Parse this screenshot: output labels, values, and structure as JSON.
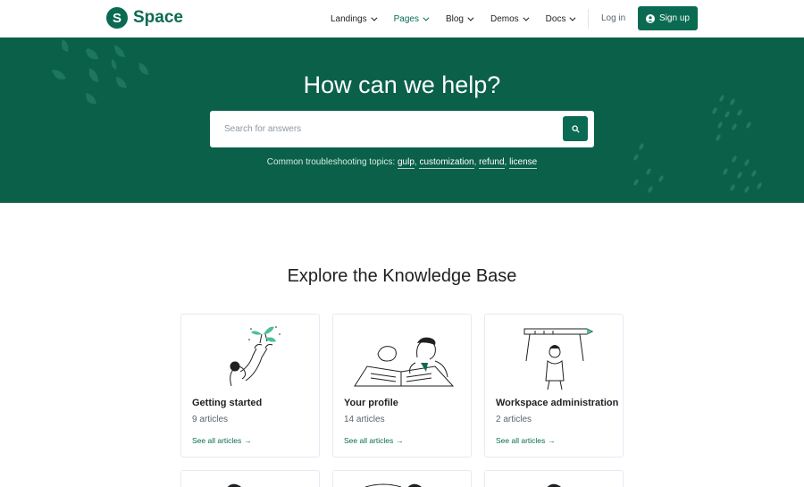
{
  "header": {
    "logo_letter": "S",
    "logo_text": "Space",
    "nav": [
      {
        "label": "Landings"
      },
      {
        "label": "Pages"
      },
      {
        "label": "Blog"
      },
      {
        "label": "Demos"
      },
      {
        "label": "Docs"
      }
    ],
    "login_label": "Log in",
    "signup_label": "Sign up"
  },
  "hero": {
    "title": "How can we help?",
    "search_placeholder": "Search for answers",
    "topics_prefix": "Common troubleshooting topics:",
    "topics": [
      "gulp",
      "customization",
      "refund",
      "license"
    ]
  },
  "knowledge_base": {
    "title": "Explore the Knowledge Base",
    "cards": [
      {
        "title": "Getting started",
        "count": "9 articles",
        "link": "See all articles"
      },
      {
        "title": "Your profile",
        "count": "14 articles",
        "link": "See all articles"
      },
      {
        "title": "Workspace administration",
        "count": "2 articles",
        "link": "See all articles"
      }
    ]
  },
  "colors": {
    "brand": "#0b6b52",
    "hero_bg": "#0b6049"
  }
}
